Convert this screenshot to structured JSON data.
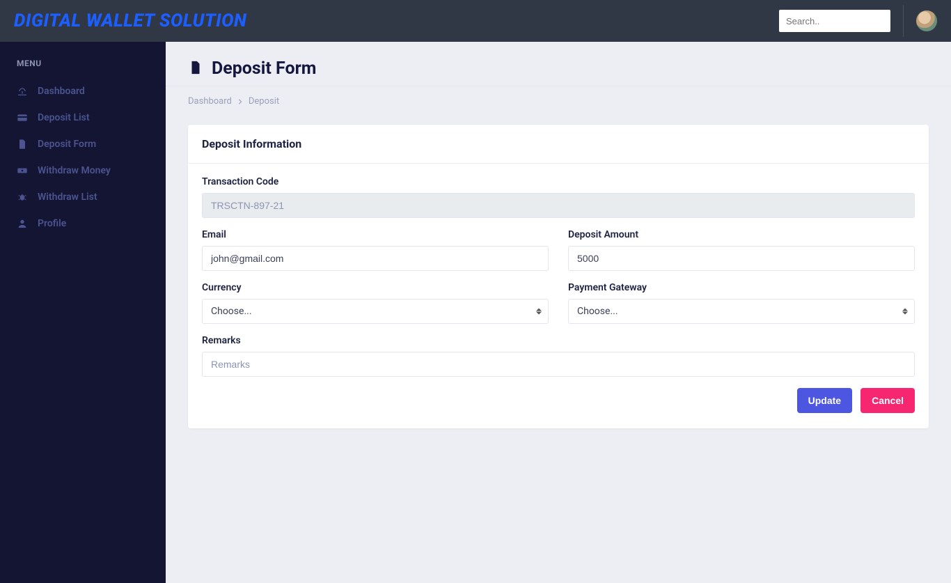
{
  "header": {
    "brand": "DIGITAL WALLET SOLUTION",
    "search_placeholder": "Search.."
  },
  "sidebar": {
    "menu_label": "MENU",
    "items": [
      {
        "label": "Dashboard",
        "icon": "dashboard"
      },
      {
        "label": "Deposit List",
        "icon": "card"
      },
      {
        "label": "Deposit Form",
        "icon": "file"
      },
      {
        "label": "Withdraw Money",
        "icon": "cash"
      },
      {
        "label": "Withdraw List",
        "icon": "bug"
      },
      {
        "label": "Profile",
        "icon": "user"
      }
    ]
  },
  "page": {
    "title": "Deposit Form",
    "breadcrumb": {
      "root": "Dashboard",
      "current": "Deposit"
    }
  },
  "card": {
    "header": "Deposit Information",
    "labels": {
      "transaction_code": "Transaction Code",
      "email": "Email",
      "deposit_amount": "Deposit Amount",
      "currency": "Currency",
      "payment_gateway": "Payment Gateway",
      "remarks": "Remarks"
    },
    "values": {
      "transaction_code": "TRSCTN-897-21",
      "email": "john@gmail.com",
      "deposit_amount": "5000",
      "currency": "Choose...",
      "payment_gateway": "Choose...",
      "remarks": ""
    },
    "placeholders": {
      "remarks": "Remarks"
    },
    "buttons": {
      "update": "Update",
      "cancel": "Cancel"
    }
  }
}
